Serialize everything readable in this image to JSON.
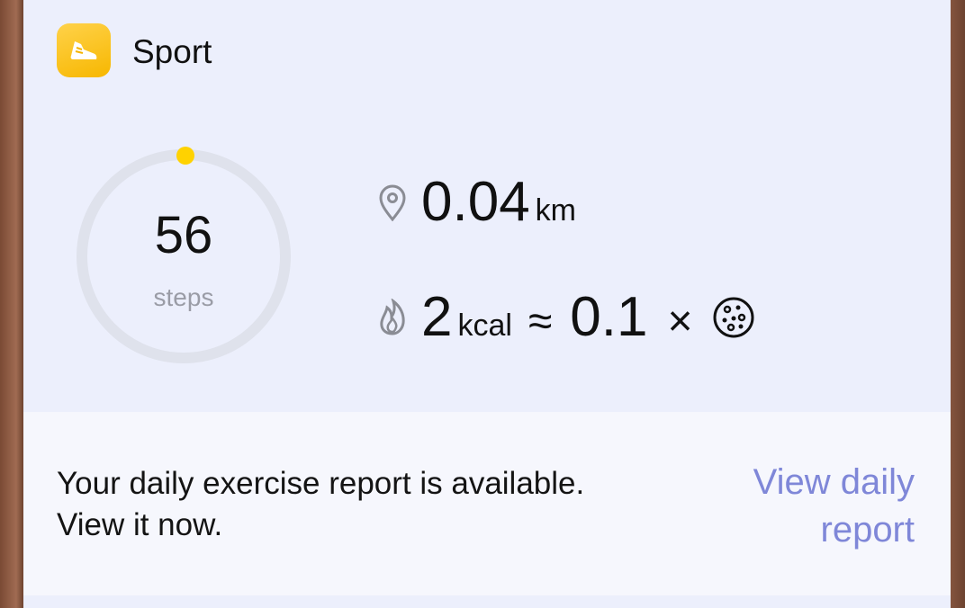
{
  "app": {
    "name": "Sport",
    "icon": "sneaker-icon",
    "accent": "#f7b700"
  },
  "steps": {
    "value": "56",
    "unit": "steps",
    "ring_track_color": "#dfe2ec",
    "progress_color": "#ffd200"
  },
  "distance": {
    "icon": "location-pin-icon",
    "value": "0.04",
    "unit": "km"
  },
  "calories": {
    "icon": "flame-icon",
    "value": "2",
    "unit": "kcal",
    "approx_symbol": "≈",
    "multiplier": "0.1",
    "times_symbol": "×",
    "food_icon": "cookie-icon"
  },
  "report": {
    "message_line1": "Your daily exercise report is available.",
    "message_line2": "View it now.",
    "link_line1": "View daily",
    "link_line2": "report",
    "link_color": "#7f87d8"
  }
}
